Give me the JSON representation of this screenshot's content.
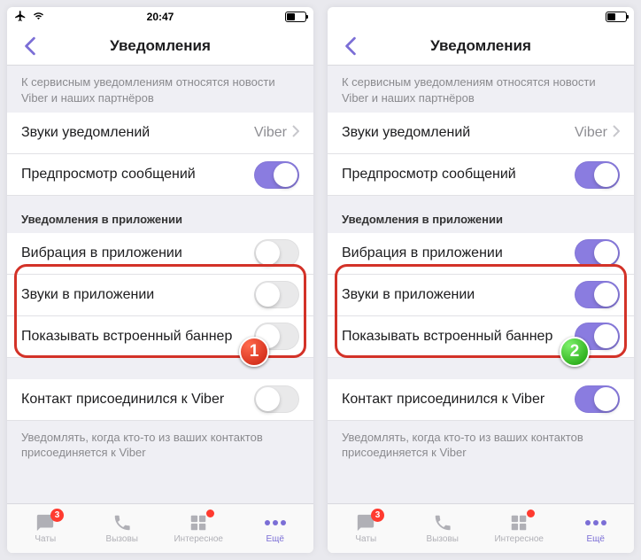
{
  "status": {
    "time": "20:47"
  },
  "nav": {
    "title": "Уведомления"
  },
  "footer_service": "К сервисным уведомлениям относятся новости Viber и наших партнёров",
  "cells": {
    "sounds": {
      "label": "Звуки уведомлений",
      "value": "Viber"
    },
    "preview": {
      "label": "Предпросмотр сообщений"
    },
    "section_inapp": "Уведомления в приложении",
    "vibrate": {
      "label": "Вибрация в приложении"
    },
    "inapp_sounds": {
      "label": "Звуки в приложении"
    },
    "banner": {
      "label": "Показывать встроенный баннер"
    },
    "contact_joined": {
      "label": "Контакт присоединился к Viber"
    },
    "footer_contact": "Уведомлять, когда кто-то из ваших контактов присоединяется к Viber"
  },
  "tabs": {
    "chats": {
      "label": "Чаты",
      "badge": "3"
    },
    "calls": {
      "label": "Вызовы"
    },
    "interesting": {
      "label": "Интересное"
    },
    "more": {
      "label": "Ещё"
    }
  },
  "badges": {
    "one": "1",
    "two": "2"
  },
  "screens": [
    {
      "vibrate_on": false,
      "inapp_sounds_on": false,
      "banner_on": false,
      "contact_on": false,
      "badge": "one",
      "badge_class": "red"
    },
    {
      "vibrate_on": true,
      "inapp_sounds_on": true,
      "banner_on": true,
      "contact_on": true,
      "badge": "two",
      "badge_class": "green"
    }
  ]
}
